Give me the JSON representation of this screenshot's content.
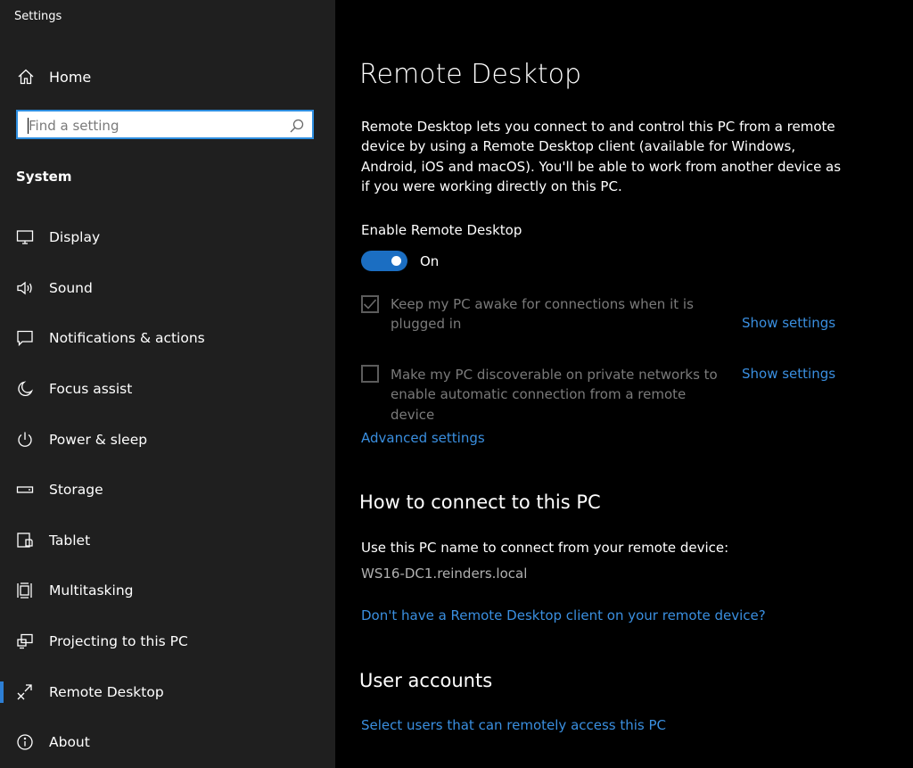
{
  "app": {
    "title": "Settings"
  },
  "sidebar": {
    "home_label": "Home",
    "search_placeholder": "Find a setting",
    "section_title": "System",
    "items": [
      {
        "label": "Display",
        "icon": "display-icon"
      },
      {
        "label": "Sound",
        "icon": "speaker-icon"
      },
      {
        "label": "Notifications & actions",
        "icon": "notification-icon"
      },
      {
        "label": "Focus assist",
        "icon": "moon-icon"
      },
      {
        "label": "Power & sleep",
        "icon": "power-icon"
      },
      {
        "label": "Storage",
        "icon": "storage-icon"
      },
      {
        "label": "Tablet",
        "icon": "tablet-icon"
      },
      {
        "label": "Multitasking",
        "icon": "multitasking-icon"
      },
      {
        "label": "Projecting to this PC",
        "icon": "projecting-icon"
      },
      {
        "label": "Remote Desktop",
        "icon": "remote-desktop-icon",
        "selected": true
      },
      {
        "label": "About",
        "icon": "info-icon"
      }
    ]
  },
  "main": {
    "title": "Remote Desktop",
    "description": "Remote Desktop lets you connect to and control this PC from a remote device by using a Remote Desktop client (available for Windows, Android, iOS and macOS). You'll be able to work from another device as if you were working directly on this PC.",
    "enable_label": "Enable Remote Desktop",
    "toggle_state": "On",
    "toggle_on": true,
    "options": [
      {
        "label": "Keep my PC awake for connections when it is plugged in",
        "checked": true,
        "link": "Show settings"
      },
      {
        "label": "Make my PC discoverable on private networks to enable automatic connection from a remote device",
        "checked": false,
        "link": "Show settings"
      }
    ],
    "advanced_link": "Advanced settings",
    "connect_heading": "How to connect to this PC",
    "connect_text": "Use this PC name to connect from your remote device:",
    "pc_name": "WS16-DC1.reinders.local",
    "client_link": "Don't have a Remote Desktop client on your remote device?",
    "accounts_heading": "User accounts",
    "accounts_link": "Select users that can remotely access this PC"
  },
  "colors": {
    "accent": "#1b6ec2",
    "link": "#3a8fe0",
    "sidebar_bg": "#1f1f1f",
    "main_bg": "#000000"
  }
}
